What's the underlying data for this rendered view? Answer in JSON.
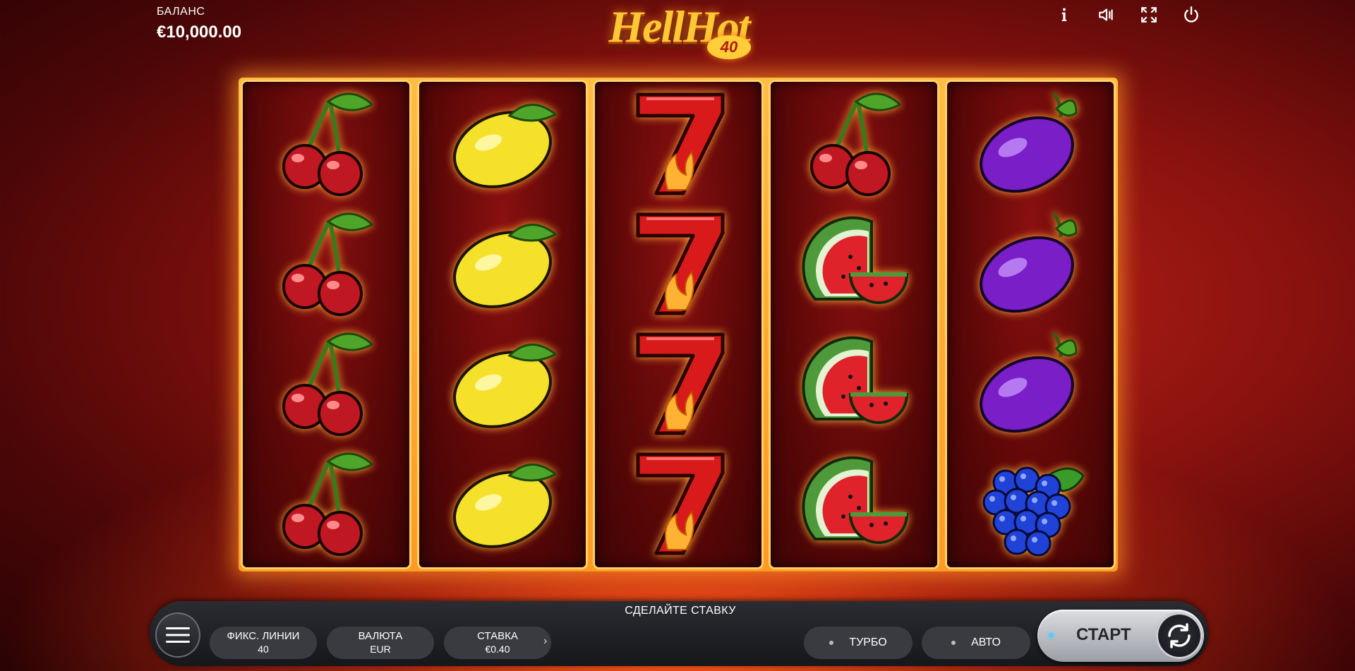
{
  "balance": {
    "label": "БАЛАНС",
    "value": "€10,000.00"
  },
  "logo": {
    "text": "HellHot",
    "badge": "40"
  },
  "top_icons": [
    "info-icon",
    "sound-icon",
    "fullscreen-icon",
    "power-icon"
  ],
  "reels": [
    [
      "cherry",
      "cherry",
      "cherry",
      "cherry"
    ],
    [
      "lemon",
      "lemon",
      "lemon",
      "lemon"
    ],
    [
      "seven",
      "seven",
      "seven",
      "seven"
    ],
    [
      "cherry",
      "watermelon",
      "watermelon",
      "watermelon"
    ],
    [
      "plum",
      "plum",
      "plum",
      "grapes"
    ]
  ],
  "controls": {
    "message": "СДЕЛАЙТЕ СТАВКУ",
    "lines": {
      "label": "ФИКС. ЛИНИИ",
      "value": "40"
    },
    "currency": {
      "label": "ВАЛЮТА",
      "value": "EUR"
    },
    "bet": {
      "label": "СТАВКА",
      "value": "€0.40"
    },
    "next_arrow": "›",
    "turbo_label": "ТУРБО",
    "auto_label": "АВТО",
    "start_label": "СТАРТ"
  },
  "colors": {
    "accent": "#ffc733",
    "start_indicator": "#5ac8ff"
  }
}
